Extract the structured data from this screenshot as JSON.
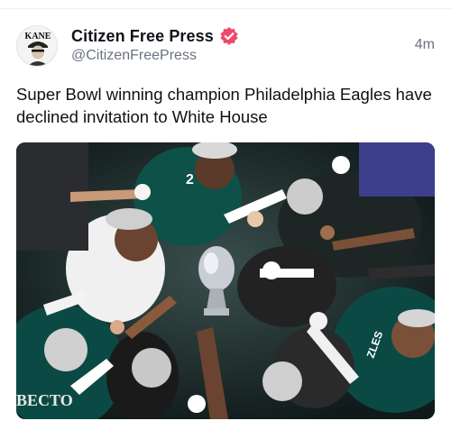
{
  "post": {
    "author_name": "Citizen Free Press",
    "author_handle": "@CitizenFreePress",
    "timestamp": "4m",
    "text": "Super Bowl winning champion Philadelphia Eagles have declined invitation to White House",
    "verified": true,
    "avatar_text": "KANE",
    "image_text": "BECTO"
  },
  "colors": {
    "verified_badge": "#f0476b",
    "eagles_green": "#0b4a44",
    "trophy": "#c9ced4"
  }
}
